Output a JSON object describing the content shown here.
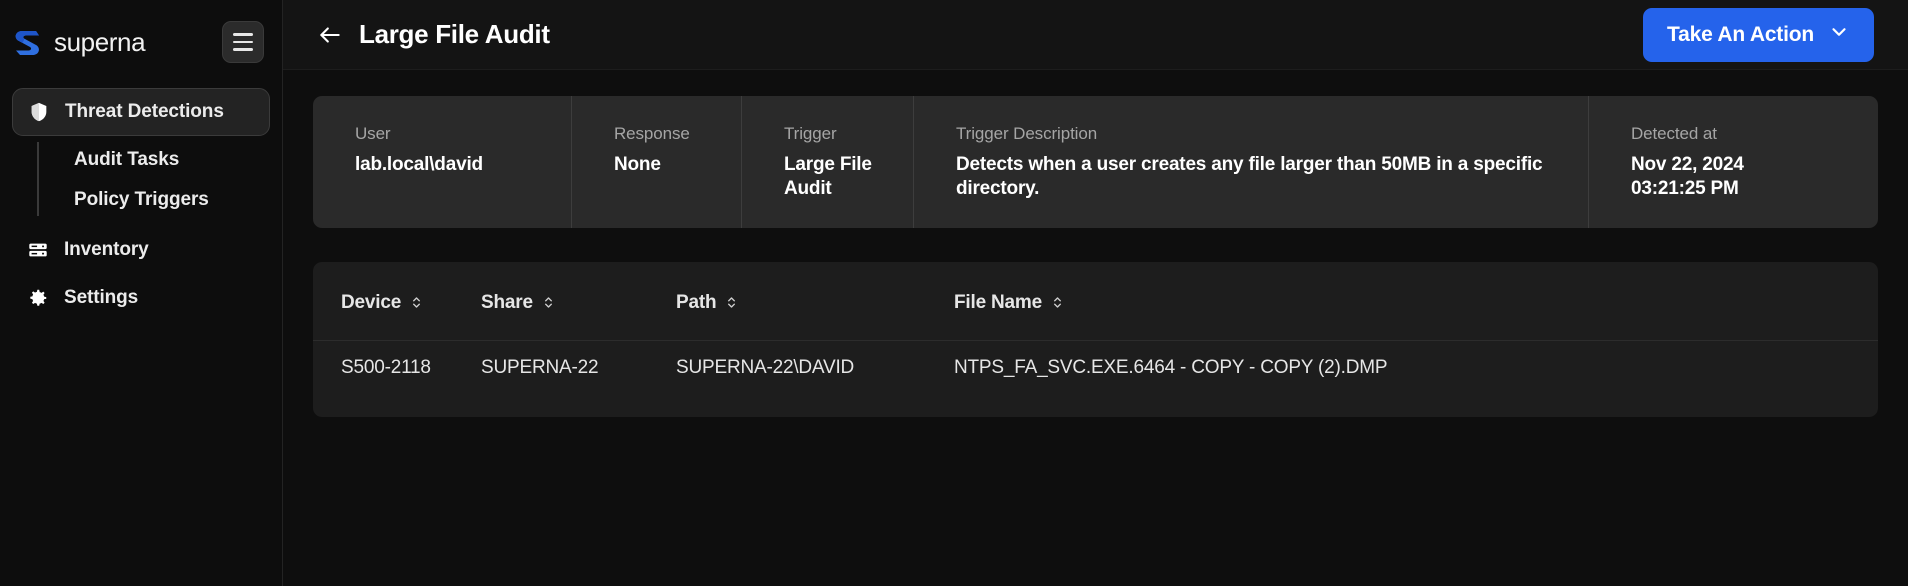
{
  "brand": {
    "name": "superna",
    "logo_icon": "superna-logo-icon",
    "menu_icon": "hamburger-icon"
  },
  "sidebar": {
    "items": [
      {
        "label": "Threat Detections",
        "icon": "shield-icon",
        "active": true
      },
      {
        "label": "Inventory",
        "icon": "server-icon",
        "active": false
      },
      {
        "label": "Settings",
        "icon": "gear-icon",
        "active": false
      }
    ],
    "subitems": [
      {
        "label": "Audit Tasks"
      },
      {
        "label": "Policy Triggers"
      }
    ]
  },
  "header": {
    "back_icon": "arrow-left-icon",
    "title": "Large File Audit",
    "action_button": {
      "label": "Take An Action",
      "icon": "chevron-down-icon",
      "color": "#2563eb"
    }
  },
  "summary": {
    "user": {
      "label": "User",
      "value": "lab.local\\david"
    },
    "response": {
      "label": "Response",
      "value": "None"
    },
    "trigger": {
      "label": "Trigger",
      "value": "Large File Audit"
    },
    "trigger_description": {
      "label": "Trigger Description",
      "value": "Detects when a user creates any file larger than 50MB in a specific directory."
    },
    "detected_at": {
      "label": "Detected at",
      "date": "Nov 22, 2024",
      "time": "03:21:25 PM"
    }
  },
  "table": {
    "columns": [
      {
        "label": "Device",
        "sort_icon": "sort-icon"
      },
      {
        "label": "Share",
        "sort_icon": "sort-icon"
      },
      {
        "label": "Path",
        "sort_icon": "sort-icon"
      },
      {
        "label": "File Name",
        "sort_icon": "sort-icon"
      }
    ],
    "rows": [
      {
        "device": "S500-2118",
        "share": "SUPERNA-22",
        "path": "SUPERNA-22\\DAVID",
        "file_name": "NTPS_FA_SVC.EXE.6464 - COPY - COPY (2).DMP"
      }
    ]
  }
}
